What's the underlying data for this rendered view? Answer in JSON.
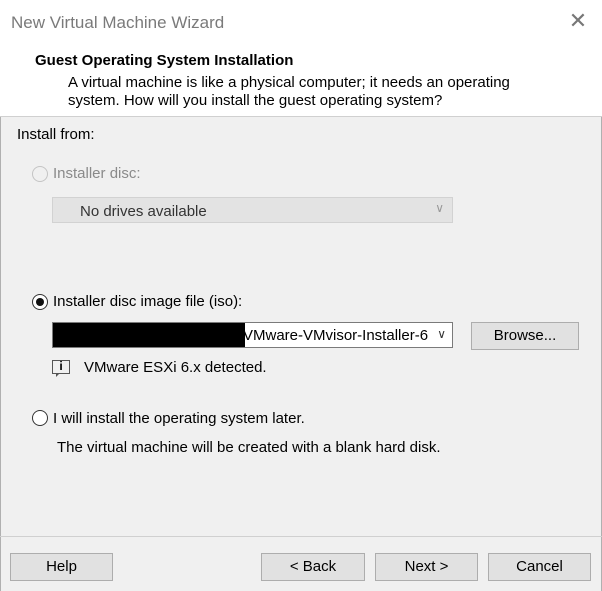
{
  "window": {
    "title": "New Virtual Machine Wizard",
    "close_symbol": "✕"
  },
  "header": {
    "title": "Guest Operating System Installation",
    "description_line1": "A virtual machine is like a physical computer; it needs an operating",
    "description_line2": "system. How will you install the guest operating system?"
  },
  "install_from": {
    "label": "Install from:",
    "disc": {
      "label": "Installer disc:",
      "selected": false,
      "enabled": false,
      "dropdown_value": "No drives available"
    },
    "iso": {
      "label": "Installer disc image file (iso):",
      "selected": true,
      "path_visible": "VMware-VMvisor-Installer-6",
      "browse_label": "Browse...",
      "detected_text": "VMware ESXi 6.x detected."
    },
    "later": {
      "label": "I will install the operating system later.",
      "selected": false,
      "note": "The virtual machine will be created with a blank hard disk."
    }
  },
  "footer": {
    "help": "Help",
    "back": "< Back",
    "next": "Next >",
    "cancel": "Cancel"
  },
  "icons": {
    "dropdown": "chevron-down-icon",
    "info": "info-icon",
    "close": "close-icon"
  },
  "colors": {
    "background": "#f0f0f0",
    "header_bg": "#ffffff",
    "button_bg": "#e1e1e1"
  }
}
